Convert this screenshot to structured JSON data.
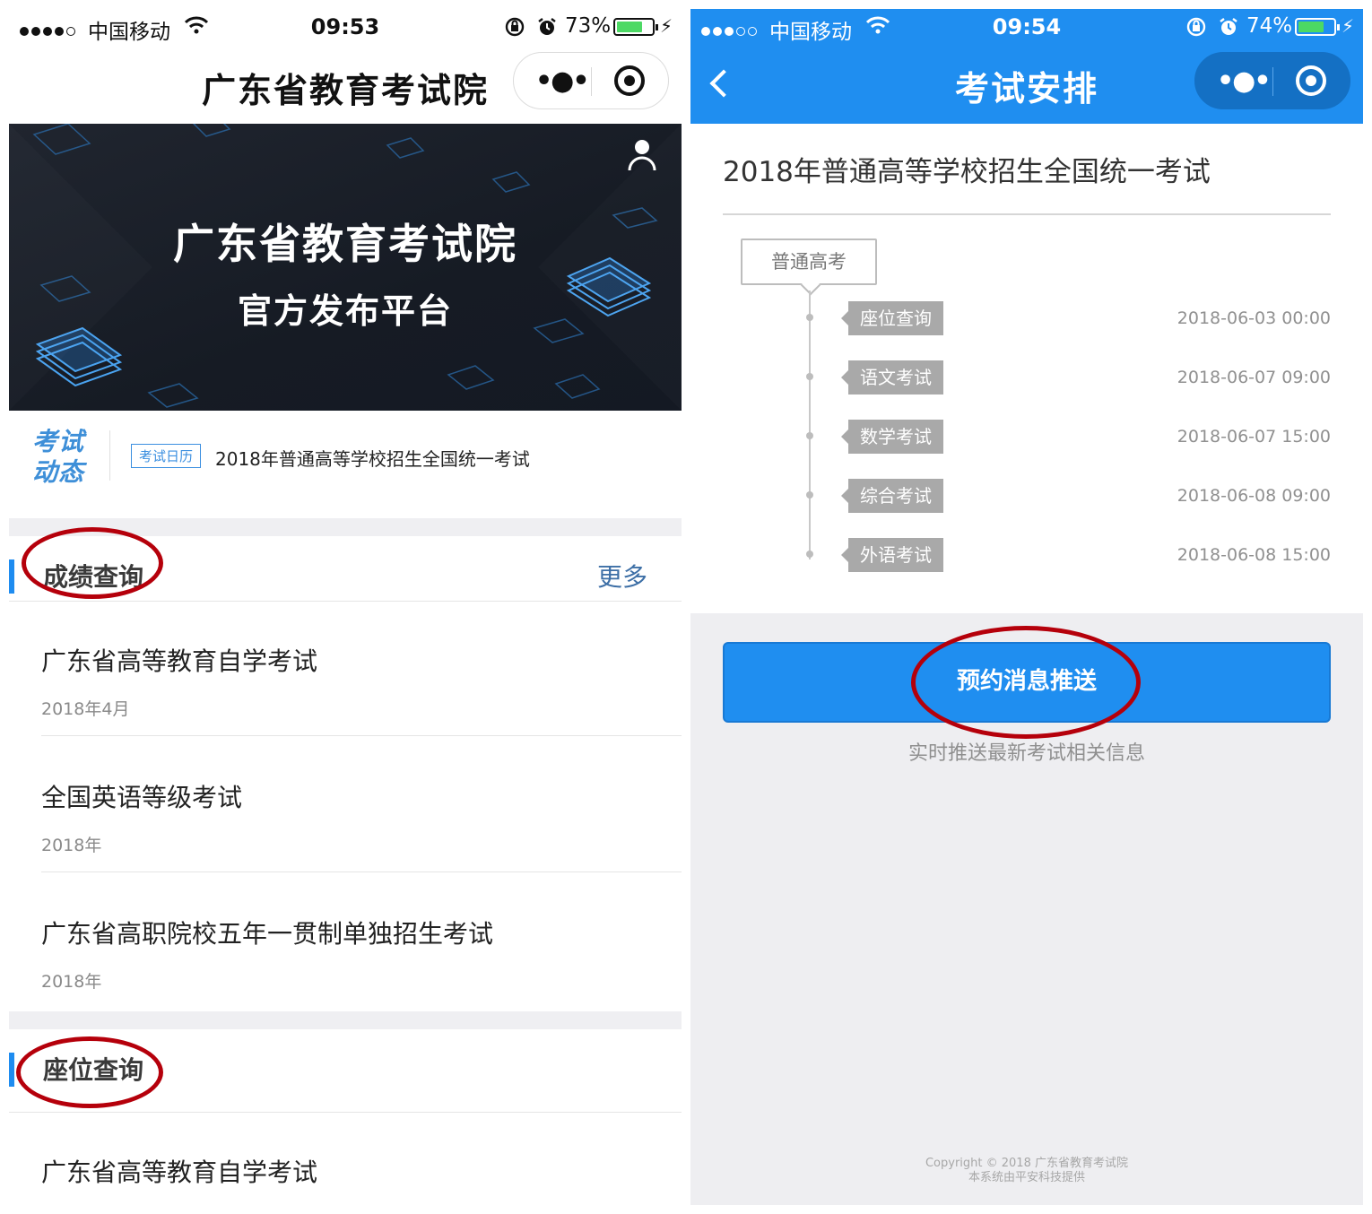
{
  "left": {
    "status": {
      "carrier": "中国移动",
      "time": "09:53",
      "battery_pct": "73%",
      "battery_level": 0.73
    },
    "nav": {
      "title": "广东省教育考试院",
      "more_icon": "more-dots-icon",
      "close_icon": "target-close-icon"
    },
    "banner": {
      "line1": "广东省教育考试院",
      "line2": "官方发布平台",
      "user_icon": "user-icon"
    },
    "news": {
      "logo_line1": "考试",
      "logo_line2": "动态",
      "tag": "考试日历",
      "text": "2018年普通高等学校招生全国统一考试"
    },
    "scores": {
      "title": "成绩查询",
      "more": "更多",
      "items": [
        {
          "name": "广东省高等教育自学考试",
          "date": "2018年4月"
        },
        {
          "name": "全国英语等级考试",
          "date": "2018年"
        },
        {
          "name": "广东省高职院校五年一贯制单独招生考试",
          "date": "2018年"
        }
      ]
    },
    "seats": {
      "title": "座位查询",
      "items": [
        {
          "name": "广东省高等教育自学考试"
        }
      ]
    }
  },
  "right": {
    "status": {
      "carrier": "中国移动",
      "time": "09:54",
      "battery_pct": "74%",
      "battery_level": 0.74
    },
    "nav": {
      "title": "考试安排",
      "back_icon": "back-chevron-icon"
    },
    "exam_title": "2018年普通高等学校招生全国统一考试",
    "category": "普通高考",
    "events": [
      {
        "label": "座位查询",
        "time": "2018-06-03 00:00"
      },
      {
        "label": "语文考试",
        "time": "2018-06-07 09:00"
      },
      {
        "label": "数学考试",
        "time": "2018-06-07 15:00"
      },
      {
        "label": "综合考试",
        "time": "2018-06-08 09:00"
      },
      {
        "label": "外语考试",
        "time": "2018-06-08 15:00"
      }
    ],
    "push_button": "预约消息推送",
    "push_hint": "实时推送最新考试相关信息",
    "footer_line1": "Copyright © 2018 广东省教育考试院",
    "footer_line2": "本系统由平安科技提供"
  },
  "colors": {
    "accent": "#1f8ef0",
    "annotation_ring": "#b5000b",
    "battery_green": "#4cd964"
  }
}
